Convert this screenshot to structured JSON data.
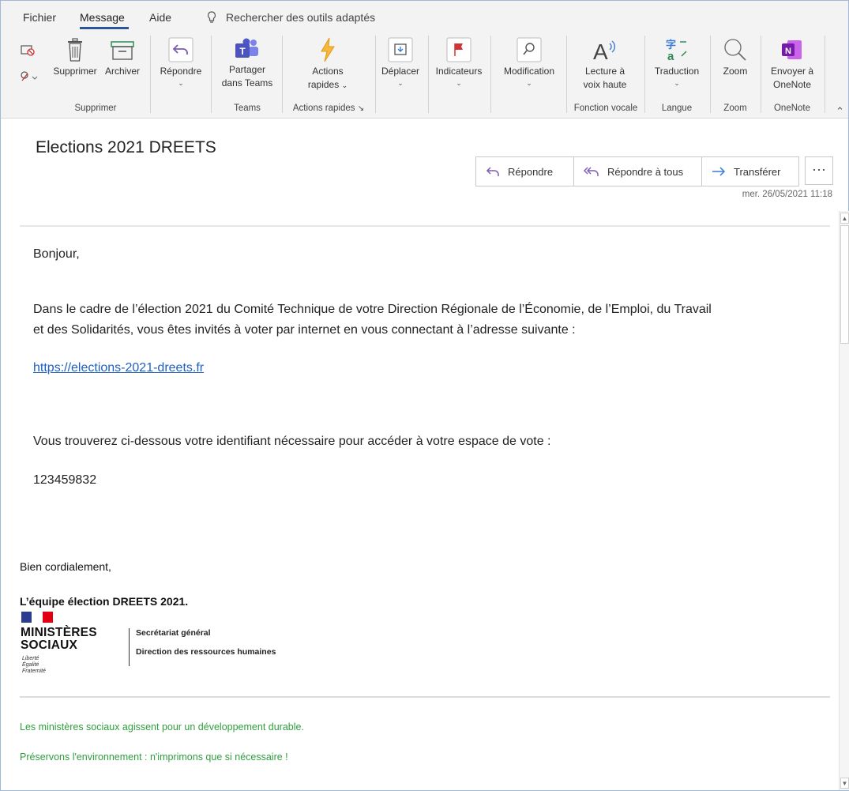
{
  "menu": {
    "tabs": [
      "Fichier",
      "Message",
      "Aide"
    ],
    "search_label": "Rechercher des outils adaptés"
  },
  "ribbon": {
    "supprimer_group": {
      "delete_label": "Supprimer",
      "archive_label": "Archiver",
      "group_label": "Supprimer"
    },
    "repondre": {
      "label": "Répondre"
    },
    "teams": {
      "label_line1": "Partager",
      "label_line2": "dans Teams",
      "group_label": "Teams"
    },
    "actions_rapides": {
      "label_line1": "Actions",
      "label_line2": "rapides",
      "group_label": "Actions rapides"
    },
    "deplacer": {
      "label": "Déplacer"
    },
    "indicateurs": {
      "label": "Indicateurs"
    },
    "modification": {
      "label": "Modification"
    },
    "lecture": {
      "label_line1": "Lecture à",
      "label_line2": "voix haute",
      "group_label": "Fonction vocale"
    },
    "traduction": {
      "label": "Traduction",
      "group_label": "Langue"
    },
    "zoom": {
      "label": "Zoom",
      "group_label": "Zoom"
    },
    "onenote": {
      "label_line1": "Envoyer à",
      "label_line2": "OneNote",
      "group_label": "OneNote"
    }
  },
  "message": {
    "subject": "Elections 2021 DREETS",
    "actions": {
      "reply": "Répondre",
      "reply_all": "Répondre à tous",
      "forward": "Transférer",
      "more": "···"
    },
    "datetime": "mer. 26/05/2021 11:18",
    "greeting": "Bonjour,",
    "paragraph_line1": "Dans le cadre de l’élection 2021 du Comité Technique de votre Direction Régionale de l’Économie, de l’Emploi, du Travail",
    "paragraph_line2": "et des Solidarités, vous êtes invités à voter par internet en vous connectant à l’adresse suivante :",
    "link": "https://elections-2021-dreets.fr",
    "identifier_intro": "Vous trouverez ci-dessous votre identifiant nécessaire pour accéder à votre espace de vote :",
    "identifier": "123459832",
    "closing": "Bien cordialement,",
    "team": "L’équipe élection DREETS 2021.",
    "logo": {
      "line1": "MINISTÈRES",
      "line2": "SOCIAUX",
      "motto1": "Liberté",
      "motto2": "Égalité",
      "motto3": "Fraternité",
      "dept1": "Secrétariat général",
      "dept2": "Direction des ressources humaines"
    },
    "footer1": "Les ministères sociaux agissent pour un développement durable.",
    "footer2": "Préservons l'environnement : n'imprimons que si nécessaire !"
  },
  "colors": {
    "accent": "#2b579a",
    "link": "#1f5fbf",
    "footer_green": "#2e9e3e"
  }
}
